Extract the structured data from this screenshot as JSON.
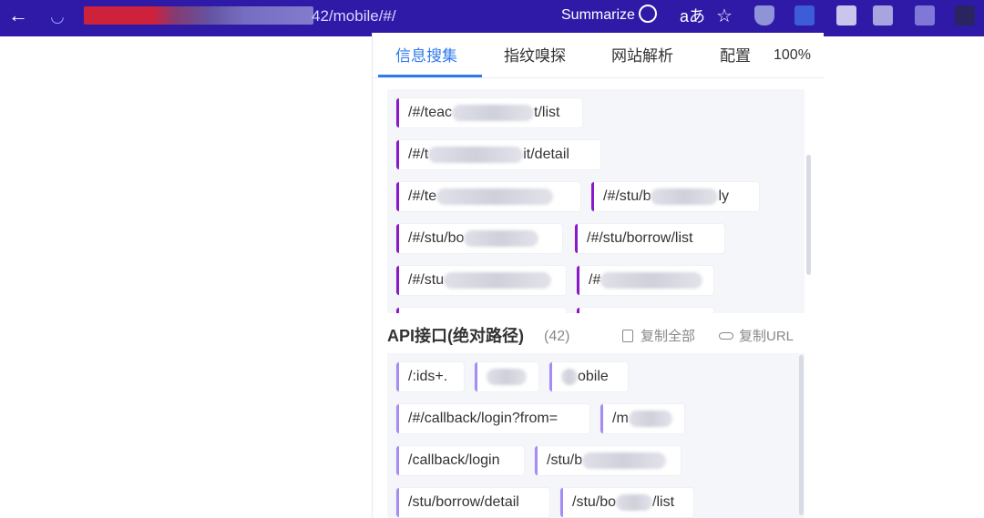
{
  "browser": {
    "url_visible": "42/mobile/#/",
    "summarize_label": "Summarize",
    "read_aloud_label": "aあ",
    "favorite_label": "☆",
    "back_label": "←",
    "reload_label": "◡"
  },
  "panel": {
    "tabs": [
      {
        "label": "信息搜集",
        "active": true
      },
      {
        "label": "指纹嗅探",
        "active": false
      },
      {
        "label": "网站解析",
        "active": false
      },
      {
        "label": "配置",
        "active": false
      }
    ],
    "zoom": "100%",
    "paths": [
      {
        "prefix": "/#/teac",
        "suffix": "t/list"
      },
      {
        "prefix": "/#/t",
        "suffix": "it/detail"
      },
      {
        "prefix": "/#/te",
        "suffix": ""
      },
      {
        "prefix": "/#/stu/b",
        "suffix": "ly"
      },
      {
        "prefix": "/#/stu/bo",
        "suffix": ""
      },
      {
        "prefix": "/#/stu/borrow/list",
        "suffix": ""
      },
      {
        "prefix": "/#/stu",
        "suffix": ""
      },
      {
        "prefix": "/#",
        "suffix": ""
      }
    ],
    "api": {
      "title": "API接口(绝对路径)",
      "count": "(42)",
      "copy_all": "复制全部",
      "copy_url": "复制URL",
      "items": [
        {
          "prefix": "/:ids+.",
          "suffix": ""
        },
        {
          "prefix": "",
          "suffix": ""
        },
        {
          "prefix": "",
          "suffix": "obile"
        },
        {
          "prefix": "/#/callback/login?from=",
          "suffix": ""
        },
        {
          "prefix": "/m",
          "suffix": ""
        },
        {
          "prefix": "/callback/login",
          "suffix": ""
        },
        {
          "prefix": "/stu/b",
          "suffix": ""
        },
        {
          "prefix": "/stu/borrow/detail",
          "suffix": ""
        },
        {
          "prefix": "/stu/bo",
          "suffix": "/list"
        }
      ]
    }
  },
  "colors": {
    "topbar": "#2f1aa8",
    "accent": "#2f79ee",
    "path_bar": "#8a18c8",
    "api_bar": "#a58cf5"
  }
}
